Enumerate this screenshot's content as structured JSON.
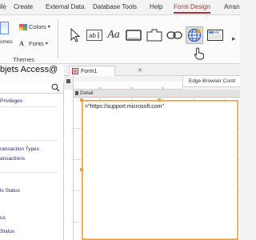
{
  "ribbon_tabs": {
    "file": "ile",
    "create": "Create",
    "external_data": "External Data",
    "database_tools": "Database Tools",
    "help": "Help",
    "form_design": "Form Design",
    "arrange": "Arran"
  },
  "themes_group": {
    "themes_label": "omes",
    "colors_label": "Colors",
    "fonts_label": "Fonts",
    "group_label": "Themes"
  },
  "controls": [
    {
      "name": "select",
      "icon": "pointer-arrow-icon"
    },
    {
      "name": "text-box",
      "icon": "text-box-icon",
      "glyph": "ab"
    },
    {
      "name": "label",
      "icon": "label-icon",
      "glyph": "Aa"
    },
    {
      "name": "button",
      "icon": "button-icon"
    },
    {
      "name": "tab-control",
      "icon": "tab-control-icon"
    },
    {
      "name": "hyperlink",
      "icon": "hyperlink-icon"
    },
    {
      "name": "web-browser",
      "icon": "globe-icon",
      "selected": true
    },
    {
      "name": "navigation",
      "icon": "navigation-icon"
    }
  ],
  "nav": {
    "title": "bjets Access@",
    "items": [
      "Privileges",
      "ransaction Types",
      "ansactions",
      "ls Status",
      "us",
      "Status"
    ]
  },
  "document": {
    "tab_label": "Form1",
    "property_title": "Edge Browser Contr",
    "section_label": "Detail",
    "control_source": "=\"https://support.microsoft.com\""
  },
  "colors": {
    "accent": "#a4373a",
    "selection_border": "#f0a13a"
  }
}
